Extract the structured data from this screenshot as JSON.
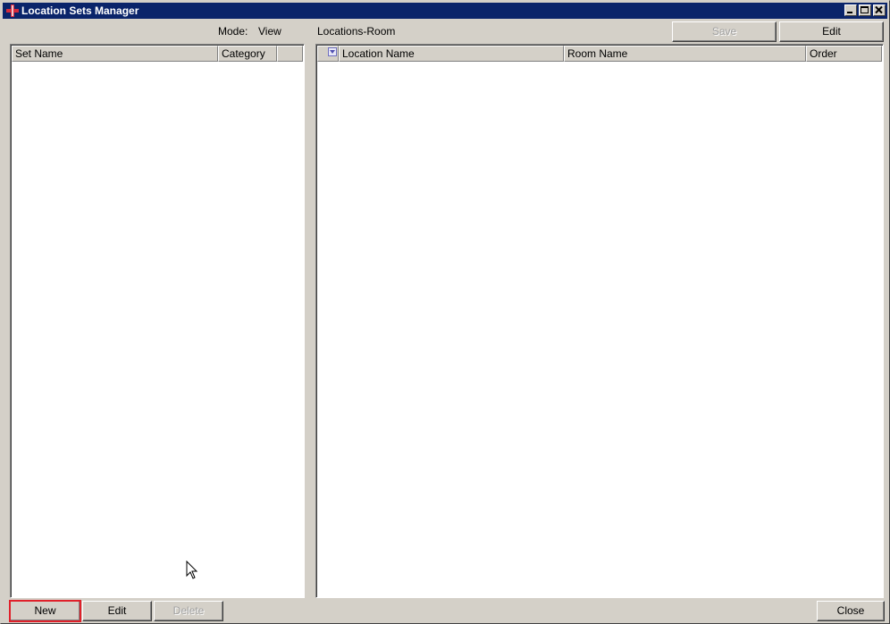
{
  "window": {
    "title": "Location Sets Manager"
  },
  "mode": {
    "label": "Mode:",
    "value": "View"
  },
  "right_panel": {
    "title": "Locations-Room"
  },
  "toolbar": {
    "save_label": "Save",
    "edit_label": "Edit"
  },
  "left_table": {
    "columns": [
      "Set Name",
      "Category",
      ""
    ]
  },
  "right_table": {
    "columns": [
      "Location Name",
      "Room Name",
      "Order"
    ]
  },
  "bottom": {
    "new_label": "New",
    "edit_label": "Edit",
    "delete_label": "Delete",
    "close_label": "Close"
  }
}
